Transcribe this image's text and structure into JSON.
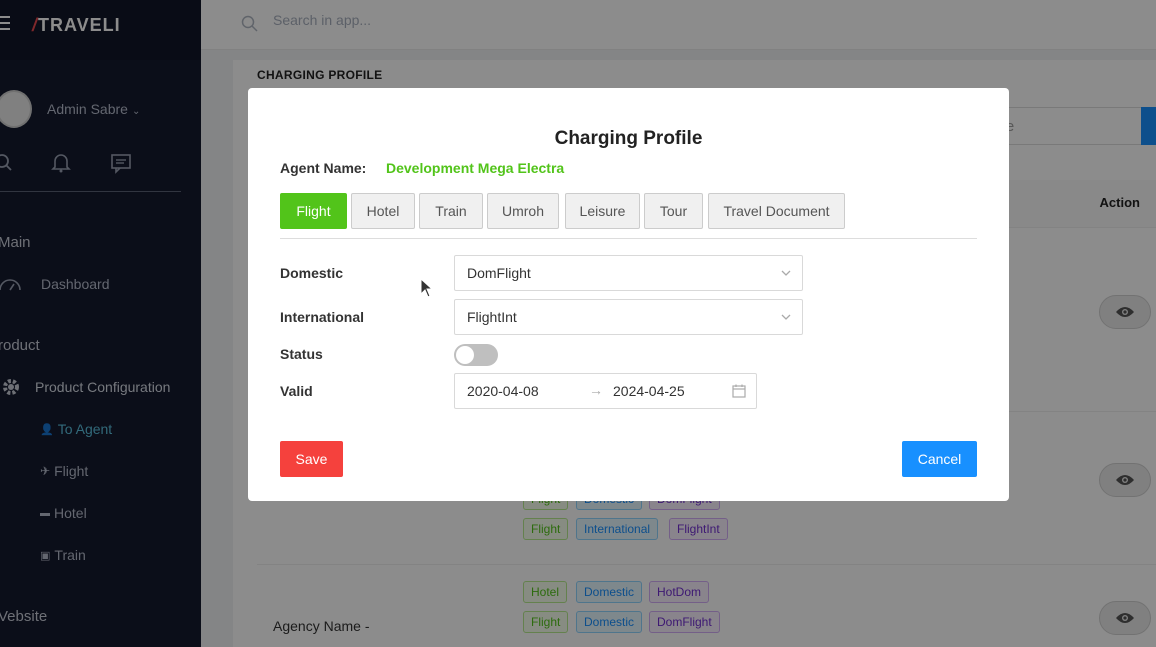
{
  "app": {
    "logo_text": "TRAVELI"
  },
  "search": {
    "placeholder": "Search in app..."
  },
  "sidebar": {
    "user_name": "Admin Sabre",
    "sections": {
      "main": "Main",
      "product": "roduct",
      "website": "Vebsite"
    },
    "items": {
      "dashboard": "Dashboard",
      "product_configuration": "Product Configuration",
      "to_agent": "To Agent",
      "flight": "Flight",
      "hotel": "Hotel",
      "train": "Train"
    }
  },
  "page": {
    "heading": "CHARGING PROFILE",
    "search_placeholder_fragment": "nt name",
    "table": {
      "action_header": "Action"
    },
    "agency_name_label": "Agency Name -",
    "tag_rows": [
      [
        {
          "text": "Flight",
          "color": "green"
        },
        {
          "text": "Domestic",
          "color": "blue"
        },
        {
          "text": "DomFlight",
          "color": "purple"
        }
      ],
      [
        {
          "text": "Flight",
          "color": "green"
        },
        {
          "text": "International",
          "color": "blue"
        },
        {
          "text": "FlightInt",
          "color": "purple"
        }
      ],
      [
        {
          "text": "Hotel",
          "color": "green"
        },
        {
          "text": "Domestic",
          "color": "blue"
        },
        {
          "text": "HotDom",
          "color": "purple"
        }
      ],
      [
        {
          "text": "Flight",
          "color": "green"
        },
        {
          "text": "Domestic",
          "color": "blue"
        },
        {
          "text": "DomFlight",
          "color": "purple"
        }
      ]
    ]
  },
  "modal": {
    "title": "Charging Profile",
    "agent_label": "Agent Name:",
    "agent_value": "Development Mega Electra",
    "tabs": [
      "Flight",
      "Hotel",
      "Train",
      "Umroh",
      "Leisure",
      "Tour",
      "Travel Document"
    ],
    "active_tab": "Flight",
    "fields": {
      "domestic_label": "Domestic",
      "domestic_value": "DomFlight",
      "international_label": "International",
      "international_value": "FlightInt",
      "status_label": "Status",
      "status_on": false,
      "valid_label": "Valid",
      "valid_start": "2020-04-08",
      "valid_separator": "→",
      "valid_end": "2024-04-25"
    },
    "save_label": "Save",
    "cancel_label": "Cancel"
  },
  "colors": {
    "sidebar_bg": "#141a2e",
    "accent_green": "#52c41a",
    "primary_blue": "#1890ff",
    "danger_red": "#f5413d"
  }
}
